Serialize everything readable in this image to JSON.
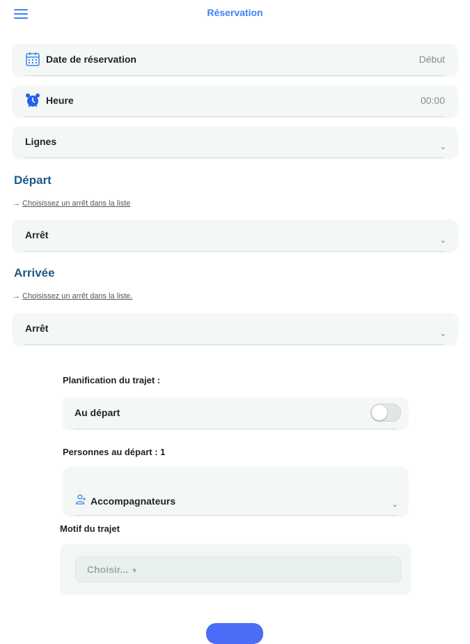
{
  "header": {
    "title": "Réservation",
    "menu_icon": "hamburger-menu-icon"
  },
  "date_field": {
    "label": "Date de réservation",
    "value": "Début",
    "icon": "calendar-icon"
  },
  "time_field": {
    "label": "Heure",
    "value": "00:00",
    "icon": "alarm-clock-icon"
  },
  "lines_field": {
    "label": "Lignes"
  },
  "departure": {
    "title": "Départ",
    "hint": "Choisissez un arrêt dans la liste",
    "stop_label": "Arrêt"
  },
  "arrival": {
    "title": "Arrivée",
    "hint": "Choisissez un arrêt dans la liste.",
    "stop_label": "Arrêt"
  },
  "planning": {
    "title": "Planification du trajet :",
    "toggle_label": "Au départ",
    "toggle_on": false
  },
  "persons": {
    "title": "Personnes au départ : 1",
    "companions_label": "Accompagnateurs",
    "companions_icon": "person-outline-icon"
  },
  "motif": {
    "title": "Motif du trajet",
    "placeholder": "Choisir..."
  },
  "colors": {
    "accent": "#3b82f6",
    "section_title": "#1e5a86",
    "field_bg": "#f3f8f6",
    "button": "#4a6cf7"
  }
}
